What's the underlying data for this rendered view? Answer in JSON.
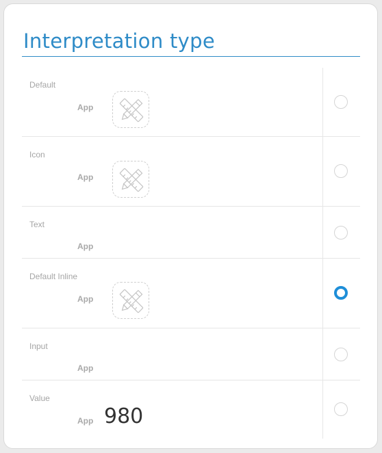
{
  "title": "Interpretation type",
  "accent_color": "#2e8bc7",
  "selected_color": "#1e8ed8",
  "options": [
    {
      "label": "Default",
      "app": "App",
      "icon": "tools-icon",
      "selected": false
    },
    {
      "label": "Icon",
      "app": "App",
      "icon": "tools-icon",
      "selected": false
    },
    {
      "label": "Text",
      "app": "App",
      "selected": false
    },
    {
      "label": "Default Inline",
      "app": "App",
      "icon": "tools-icon",
      "selected": true
    },
    {
      "label": "Input",
      "app": "App",
      "selected": false
    },
    {
      "label": "Value",
      "app": "App",
      "value": "980",
      "selected": false
    }
  ]
}
